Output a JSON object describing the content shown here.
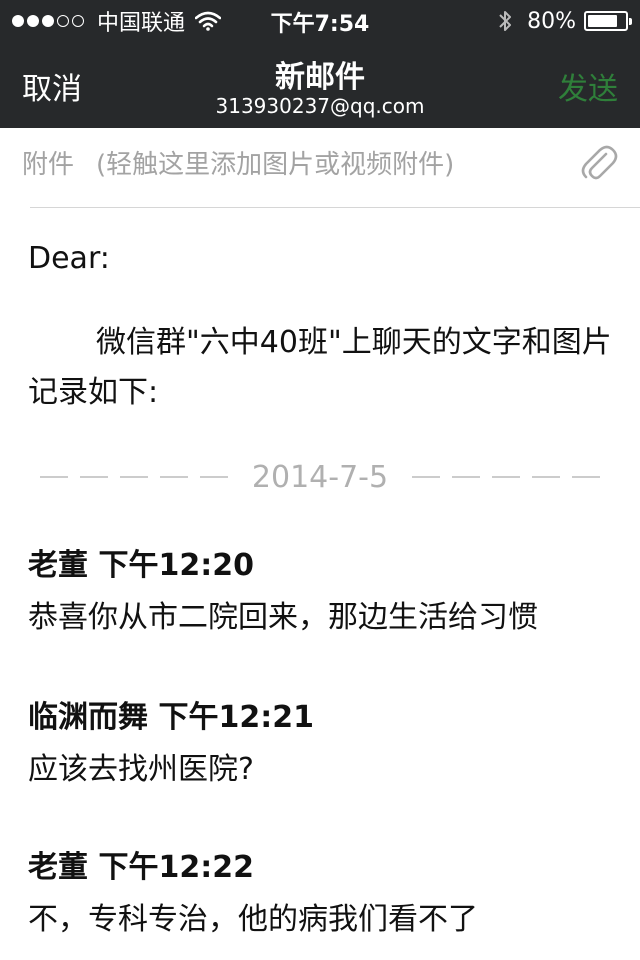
{
  "status_bar": {
    "carrier": "中国联通",
    "time": "下午7:54",
    "battery_percent_text": "80%",
    "battery_level": 0.8,
    "signal_bars_filled": 3,
    "signal_bars_total": 5
  },
  "nav": {
    "cancel_label": "取消",
    "title": "新邮件",
    "subtitle": "313930237@qq.com",
    "send_label": "发送"
  },
  "attachment": {
    "label": "附件",
    "hint": "(轻触这里添加图片或视频附件)"
  },
  "body": {
    "greeting": "Dear:",
    "intro": "微信群\"六中40班\"上聊天的文字和图片记录如下:",
    "date": "2014-7-5",
    "messages": [
      {
        "sender_time": "老董 下午12:20",
        "text": "恭喜你从市二院回来，那边生活给习惯"
      },
      {
        "sender_time": "临渊而舞 下午12:21",
        "text": "应该去找州医院?"
      },
      {
        "sender_time": "老董 下午12:22",
        "text": "不，专科专治，他的病我们看不了"
      }
    ]
  },
  "colors": {
    "header_bg": "#27292b",
    "send_disabled": "#2f7f3a",
    "placeholder_gray": "#a3a3a3"
  },
  "icons": [
    "wifi-icon",
    "bluetooth-icon",
    "battery-icon",
    "paperclip-icon"
  ]
}
